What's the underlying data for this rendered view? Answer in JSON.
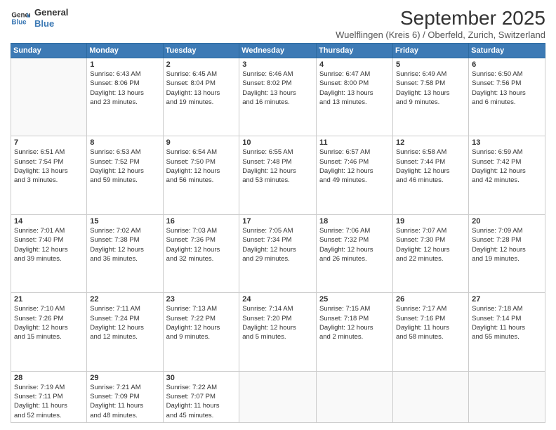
{
  "logo": {
    "line1": "General",
    "line2": "Blue"
  },
  "title": "September 2025",
  "subtitle": "Wuelflingen (Kreis 6) / Oberfeld, Zurich, Switzerland",
  "days_header": [
    "Sunday",
    "Monday",
    "Tuesday",
    "Wednesday",
    "Thursday",
    "Friday",
    "Saturday"
  ],
  "weeks": [
    [
      {
        "day": "",
        "info": ""
      },
      {
        "day": "1",
        "info": "Sunrise: 6:43 AM\nSunset: 8:06 PM\nDaylight: 13 hours\nand 23 minutes."
      },
      {
        "day": "2",
        "info": "Sunrise: 6:45 AM\nSunset: 8:04 PM\nDaylight: 13 hours\nand 19 minutes."
      },
      {
        "day": "3",
        "info": "Sunrise: 6:46 AM\nSunset: 8:02 PM\nDaylight: 13 hours\nand 16 minutes."
      },
      {
        "day": "4",
        "info": "Sunrise: 6:47 AM\nSunset: 8:00 PM\nDaylight: 13 hours\nand 13 minutes."
      },
      {
        "day": "5",
        "info": "Sunrise: 6:49 AM\nSunset: 7:58 PM\nDaylight: 13 hours\nand 9 minutes."
      },
      {
        "day": "6",
        "info": "Sunrise: 6:50 AM\nSunset: 7:56 PM\nDaylight: 13 hours\nand 6 minutes."
      }
    ],
    [
      {
        "day": "7",
        "info": "Sunrise: 6:51 AM\nSunset: 7:54 PM\nDaylight: 13 hours\nand 3 minutes."
      },
      {
        "day": "8",
        "info": "Sunrise: 6:53 AM\nSunset: 7:52 PM\nDaylight: 12 hours\nand 59 minutes."
      },
      {
        "day": "9",
        "info": "Sunrise: 6:54 AM\nSunset: 7:50 PM\nDaylight: 12 hours\nand 56 minutes."
      },
      {
        "day": "10",
        "info": "Sunrise: 6:55 AM\nSunset: 7:48 PM\nDaylight: 12 hours\nand 53 minutes."
      },
      {
        "day": "11",
        "info": "Sunrise: 6:57 AM\nSunset: 7:46 PM\nDaylight: 12 hours\nand 49 minutes."
      },
      {
        "day": "12",
        "info": "Sunrise: 6:58 AM\nSunset: 7:44 PM\nDaylight: 12 hours\nand 46 minutes."
      },
      {
        "day": "13",
        "info": "Sunrise: 6:59 AM\nSunset: 7:42 PM\nDaylight: 12 hours\nand 42 minutes."
      }
    ],
    [
      {
        "day": "14",
        "info": "Sunrise: 7:01 AM\nSunset: 7:40 PM\nDaylight: 12 hours\nand 39 minutes."
      },
      {
        "day": "15",
        "info": "Sunrise: 7:02 AM\nSunset: 7:38 PM\nDaylight: 12 hours\nand 36 minutes."
      },
      {
        "day": "16",
        "info": "Sunrise: 7:03 AM\nSunset: 7:36 PM\nDaylight: 12 hours\nand 32 minutes."
      },
      {
        "day": "17",
        "info": "Sunrise: 7:05 AM\nSunset: 7:34 PM\nDaylight: 12 hours\nand 29 minutes."
      },
      {
        "day": "18",
        "info": "Sunrise: 7:06 AM\nSunset: 7:32 PM\nDaylight: 12 hours\nand 26 minutes."
      },
      {
        "day": "19",
        "info": "Sunrise: 7:07 AM\nSunset: 7:30 PM\nDaylight: 12 hours\nand 22 minutes."
      },
      {
        "day": "20",
        "info": "Sunrise: 7:09 AM\nSunset: 7:28 PM\nDaylight: 12 hours\nand 19 minutes."
      }
    ],
    [
      {
        "day": "21",
        "info": "Sunrise: 7:10 AM\nSunset: 7:26 PM\nDaylight: 12 hours\nand 15 minutes."
      },
      {
        "day": "22",
        "info": "Sunrise: 7:11 AM\nSunset: 7:24 PM\nDaylight: 12 hours\nand 12 minutes."
      },
      {
        "day": "23",
        "info": "Sunrise: 7:13 AM\nSunset: 7:22 PM\nDaylight: 12 hours\nand 9 minutes."
      },
      {
        "day": "24",
        "info": "Sunrise: 7:14 AM\nSunset: 7:20 PM\nDaylight: 12 hours\nand 5 minutes."
      },
      {
        "day": "25",
        "info": "Sunrise: 7:15 AM\nSunset: 7:18 PM\nDaylight: 12 hours\nand 2 minutes."
      },
      {
        "day": "26",
        "info": "Sunrise: 7:17 AM\nSunset: 7:16 PM\nDaylight: 11 hours\nand 58 minutes."
      },
      {
        "day": "27",
        "info": "Sunrise: 7:18 AM\nSunset: 7:14 PM\nDaylight: 11 hours\nand 55 minutes."
      }
    ],
    [
      {
        "day": "28",
        "info": "Sunrise: 7:19 AM\nSunset: 7:11 PM\nDaylight: 11 hours\nand 52 minutes."
      },
      {
        "day": "29",
        "info": "Sunrise: 7:21 AM\nSunset: 7:09 PM\nDaylight: 11 hours\nand 48 minutes."
      },
      {
        "day": "30",
        "info": "Sunrise: 7:22 AM\nSunset: 7:07 PM\nDaylight: 11 hours\nand 45 minutes."
      },
      {
        "day": "",
        "info": ""
      },
      {
        "day": "",
        "info": ""
      },
      {
        "day": "",
        "info": ""
      },
      {
        "day": "",
        "info": ""
      }
    ]
  ]
}
